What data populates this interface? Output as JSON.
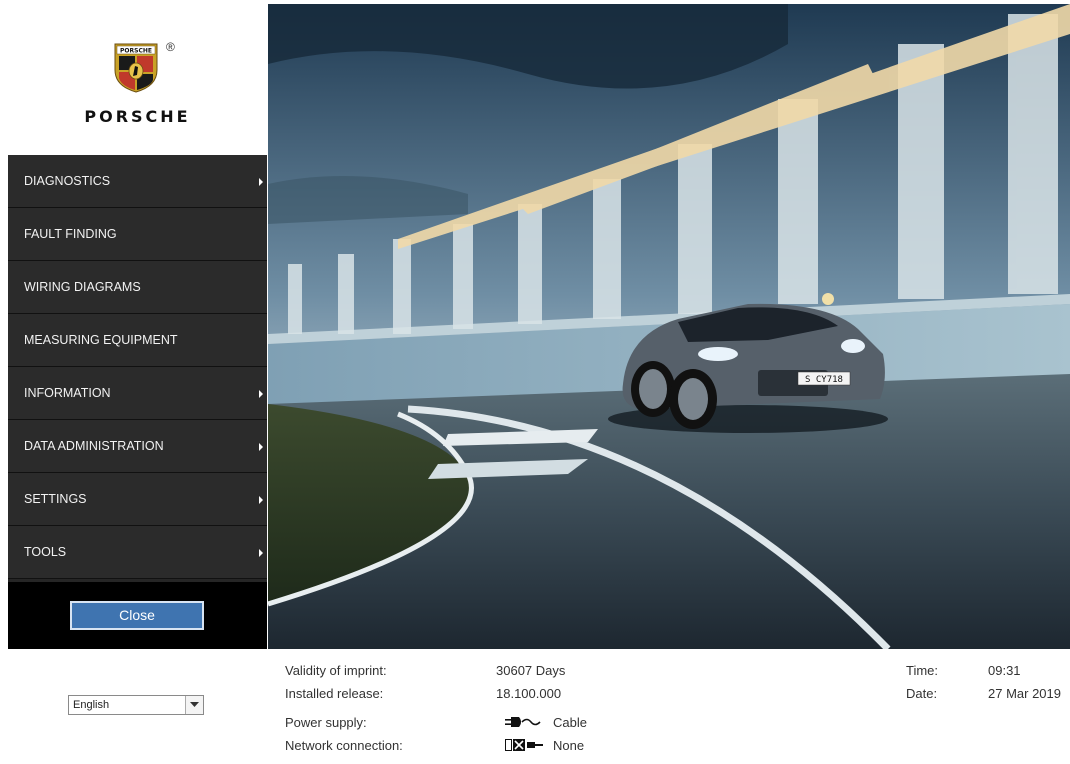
{
  "brand": {
    "wordmark": "PORSCHE",
    "registered": "®",
    "crest_text": "PORSCHE"
  },
  "menu": {
    "items": [
      {
        "label": "DIAGNOSTICS",
        "has_submenu": true
      },
      {
        "label": "FAULT FINDING",
        "has_submenu": false
      },
      {
        "label": "WIRING DIAGRAMS",
        "has_submenu": false
      },
      {
        "label": "MEASURING EQUIPMENT",
        "has_submenu": false
      },
      {
        "label": "INFORMATION",
        "has_submenu": true
      },
      {
        "label": "DATA ADMINISTRATION",
        "has_submenu": true
      },
      {
        "label": "SETTINGS",
        "has_submenu": true
      },
      {
        "label": "TOOLS",
        "has_submenu": true
      }
    ],
    "close_label": "Close"
  },
  "hero": {
    "license_plate": "S CY718"
  },
  "language": {
    "selected": "English"
  },
  "status": {
    "validity_label": "Validity of imprint:",
    "validity_value": "30607 Days",
    "release_label": "Installed release:",
    "release_value": "18.100.000",
    "power_label": "Power supply:",
    "power_value": "Cable",
    "power_icon": "plug-cable-icon",
    "network_label": "Network connection:",
    "network_value": "None",
    "network_icon": "network-disconnected-icon",
    "time_label": "Time:",
    "time_value": "09:31",
    "date_label": "Date:",
    "date_value": "27 Mar 2019"
  },
  "colors": {
    "menu_bg": "#2b2b2b",
    "close_bg": "#000000",
    "close_button": "#3f74b0"
  }
}
